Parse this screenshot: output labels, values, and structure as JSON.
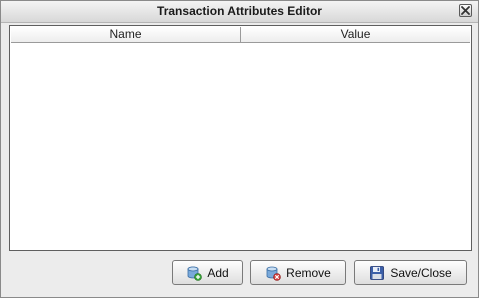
{
  "window": {
    "title": "Transaction Attributes Editor"
  },
  "table": {
    "columns": [
      "Name",
      "Value"
    ],
    "rows": []
  },
  "buttons": {
    "add": "Add",
    "remove": "Remove",
    "save_close": "Save/Close"
  },
  "icons": {
    "close": "close-icon",
    "add": "add-database-icon",
    "remove": "remove-database-icon",
    "save": "floppy-disk-icon"
  }
}
